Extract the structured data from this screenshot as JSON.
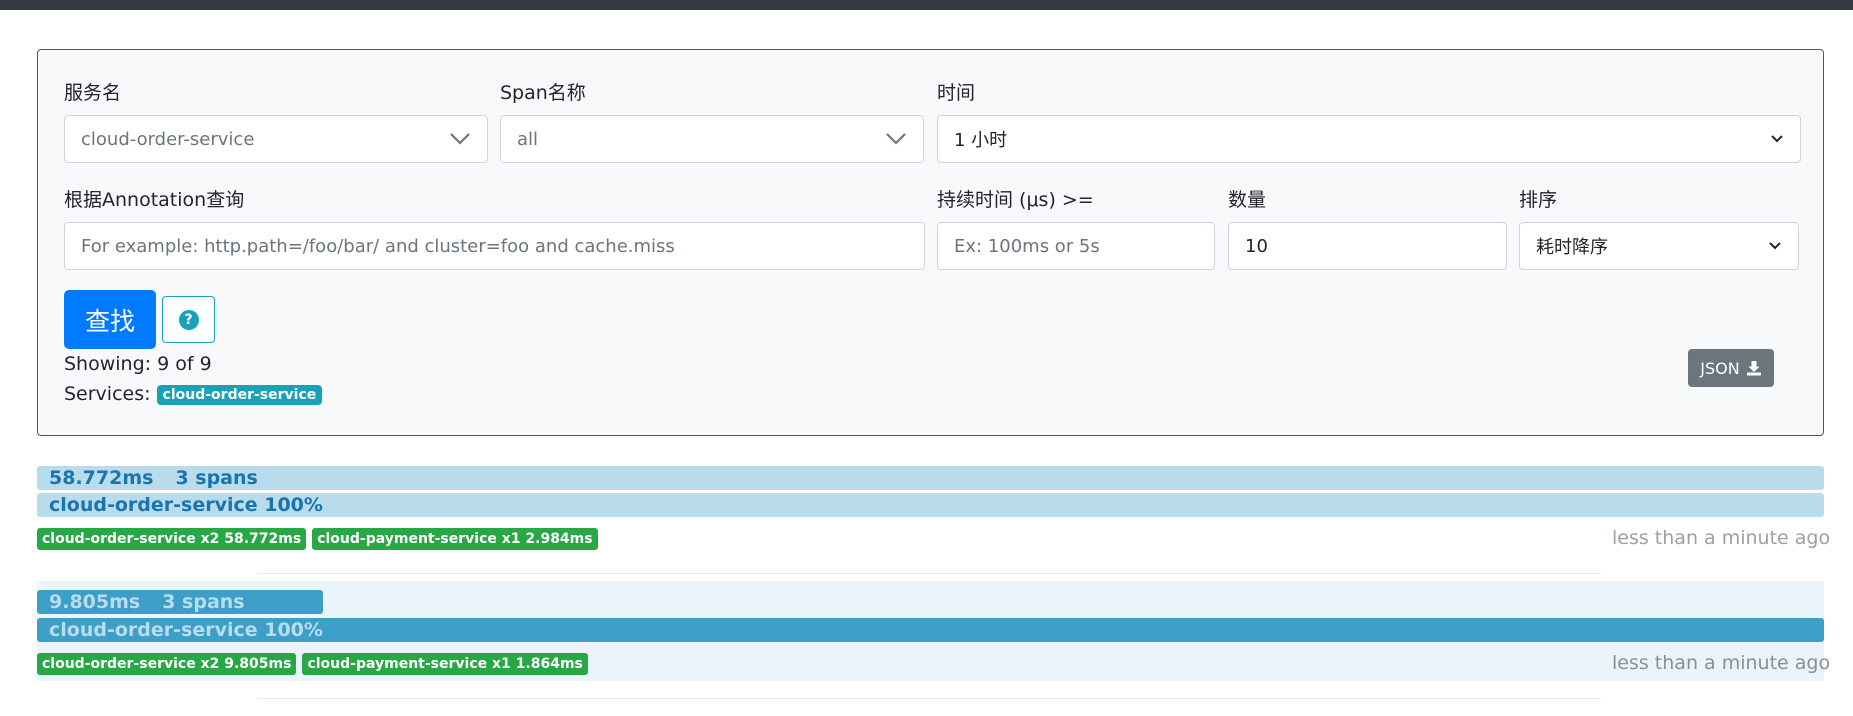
{
  "search": {
    "service_label": "服务名",
    "service_value": "cloud-order-service",
    "span_label": "Span名称",
    "span_value": "all",
    "time_label": "时间",
    "time_value": "1 小时",
    "annotation_label": "根据Annotation查询",
    "annotation_placeholder": "For example: http.path=/foo/bar/ and cluster=foo and cache.miss",
    "duration_label": "持续时间 (μs) >=",
    "duration_placeholder": "Ex: 100ms or 5s",
    "limit_label": "数量",
    "limit_value": "10",
    "sort_label": "排序",
    "sort_value": "耗时降序",
    "find_button": "查找",
    "showing_text": "Showing: 9 of 9",
    "services_label": "Services:",
    "services_badge": "cloud-order-service",
    "json_button": "JSON"
  },
  "traces": [
    {
      "duration": "58.772ms",
      "spans": "3 spans",
      "service_percent": "cloud-order-service 100%",
      "tags": [
        "cloud-order-service x2 58.772ms",
        "cloud-payment-service x1 2.984ms"
      ],
      "time_ago": "less than a minute ago"
    },
    {
      "duration": "9.805ms",
      "spans": "3 spans",
      "service_percent": "cloud-order-service 100%",
      "tags": [
        "cloud-order-service x2 9.805ms",
        "cloud-payment-service x1 1.864ms"
      ],
      "time_ago": "less than a minute ago"
    }
  ],
  "colors": {
    "primary": "#007bff",
    "info": "#17a2b8",
    "success": "#28a745",
    "secondary": "#6c757d",
    "bar_light": "#b8dcec",
    "bar_dark": "#3d9fc8"
  },
  "icons": [
    "chevron-down-icon",
    "question-circle-icon",
    "download-icon"
  ]
}
